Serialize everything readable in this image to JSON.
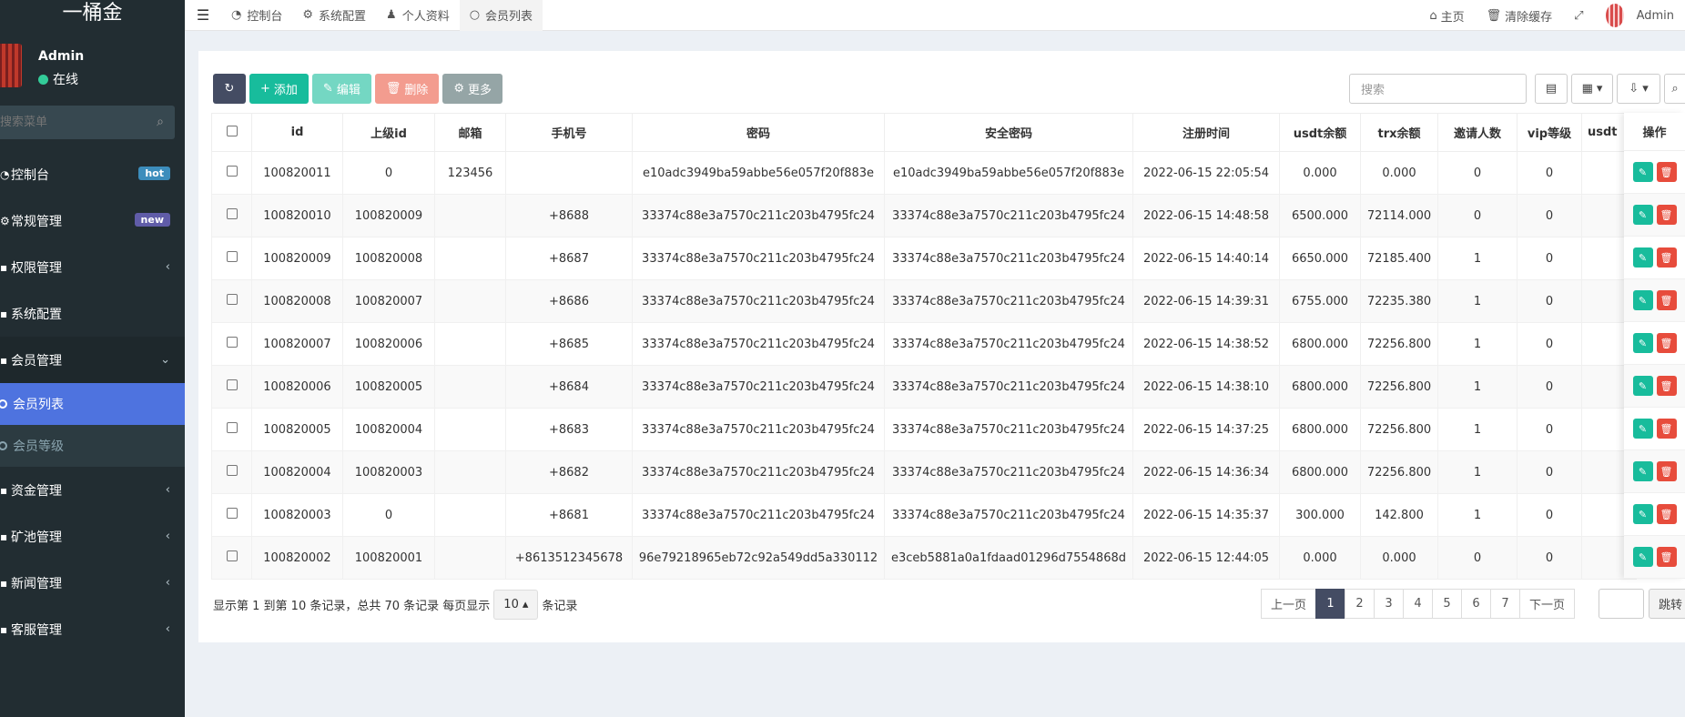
{
  "sidebar": {
    "brand": "一桶金",
    "user_name": "Admin",
    "user_status": "在线",
    "search_placeholder": "搜索菜单",
    "menu": {
      "dashboard": {
        "label": "控制台",
        "badge": "hot"
      },
      "general": {
        "label": "常规管理",
        "badge": "new"
      },
      "permission": {
        "label": "权限管理"
      },
      "sysconfig": {
        "label": "系统配置"
      },
      "member": {
        "label": "会员管理"
      },
      "member_list": {
        "label": "会员列表"
      },
      "member_level": {
        "label": "会员等级"
      },
      "finance": {
        "label": "资金管理"
      },
      "pool": {
        "label": "矿池管理"
      },
      "news": {
        "label": "新闻管理"
      },
      "service": {
        "label": "客服管理"
      }
    }
  },
  "topnav": {
    "tabs": [
      "控制台",
      "系统配置",
      "个人资料",
      "会员列表"
    ],
    "home": "主页",
    "clear_cache": "清除缓存",
    "admin": "Admin"
  },
  "toolbar": {
    "add": "添加",
    "edit": "编辑",
    "delete": "删除",
    "more": "更多",
    "search_placeholder": "搜索"
  },
  "table": {
    "headers": [
      "id",
      "上级id",
      "邮箱",
      "手机号",
      "密码",
      "安全密码",
      "注册时间",
      "usdt余额",
      "trx余额",
      "邀请人数",
      "vip等级",
      "usdt"
    ],
    "ops_header": "操作",
    "rows": [
      [
        "100820011",
        "0",
        "123456",
        "",
        "e10adc3949ba59abbe56e057f20f883e",
        "e10adc3949ba59abbe56e057f20f883e",
        "2022-06-15 22:05:54",
        "0.000",
        "0.000",
        "0",
        "0",
        ""
      ],
      [
        "100820010",
        "100820009",
        "",
        "+8688",
        "33374c88e3a7570c211c203b4795fc24",
        "33374c88e3a7570c211c203b4795fc24",
        "2022-06-15 14:48:58",
        "6500.000",
        "72114.000",
        "0",
        "0",
        ""
      ],
      [
        "100820009",
        "100820008",
        "",
        "+8687",
        "33374c88e3a7570c211c203b4795fc24",
        "33374c88e3a7570c211c203b4795fc24",
        "2022-06-15 14:40:14",
        "6650.000",
        "72185.400",
        "1",
        "0",
        ""
      ],
      [
        "100820008",
        "100820007",
        "",
        "+8686",
        "33374c88e3a7570c211c203b4795fc24",
        "33374c88e3a7570c211c203b4795fc24",
        "2022-06-15 14:39:31",
        "6755.000",
        "72235.380",
        "1",
        "0",
        ""
      ],
      [
        "100820007",
        "100820006",
        "",
        "+8685",
        "33374c88e3a7570c211c203b4795fc24",
        "33374c88e3a7570c211c203b4795fc24",
        "2022-06-15 14:38:52",
        "6800.000",
        "72256.800",
        "1",
        "0",
        ""
      ],
      [
        "100820006",
        "100820005",
        "",
        "+8684",
        "33374c88e3a7570c211c203b4795fc24",
        "33374c88e3a7570c211c203b4795fc24",
        "2022-06-15 14:38:10",
        "6800.000",
        "72256.800",
        "1",
        "0",
        ""
      ],
      [
        "100820005",
        "100820004",
        "",
        "+8683",
        "33374c88e3a7570c211c203b4795fc24",
        "33374c88e3a7570c211c203b4795fc24",
        "2022-06-15 14:37:25",
        "6800.000",
        "72256.800",
        "1",
        "0",
        ""
      ],
      [
        "100820004",
        "100820003",
        "",
        "+8682",
        "33374c88e3a7570c211c203b4795fc24",
        "33374c88e3a7570c211c203b4795fc24",
        "2022-06-15 14:36:34",
        "6800.000",
        "72256.800",
        "1",
        "0",
        ""
      ],
      [
        "100820003",
        "0",
        "",
        "+8681",
        "33374c88e3a7570c211c203b4795fc24",
        "33374c88e3a7570c211c203b4795fc24",
        "2022-06-15 14:35:37",
        "300.000",
        "142.800",
        "1",
        "0",
        ""
      ],
      [
        "100820002",
        "100820001",
        "",
        "+8613512345678",
        "96e79218965eb72c92a549dd5a330112",
        "e3ceb5881a0a1fdaad01296d7554868d",
        "2022-06-15 12:44:05",
        "0.000",
        "0.000",
        "0",
        "0",
        ""
      ]
    ]
  },
  "footer": {
    "info_prefix": "显示第 1 到第 10 条记录，总共 70 条记录 每页显示",
    "page_size": "10",
    "info_suffix": "条记录",
    "prev": "上一页",
    "pages": [
      "1",
      "2",
      "3",
      "4",
      "5",
      "6",
      "7"
    ],
    "next": "下一页",
    "jump": "跳转"
  },
  "colors": {
    "sidebar_bg": "#222d32",
    "active_item": "#4e73df",
    "accent_green": "#18bc9c",
    "danger": "#e74c3c",
    "pager_active": "#444c63"
  }
}
